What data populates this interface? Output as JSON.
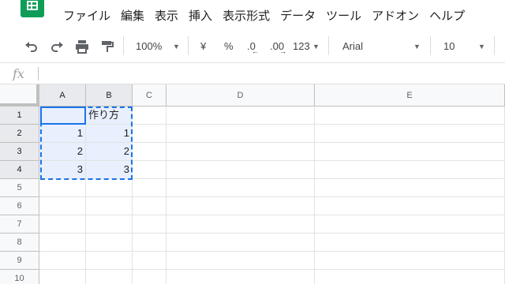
{
  "menu": {
    "items": [
      "ファイル",
      "編集",
      "表示",
      "挿入",
      "表示形式",
      "データ",
      "ツール",
      "アドオン",
      "ヘルプ"
    ]
  },
  "toolbar": {
    "undo_icon": "undo-icon",
    "redo_icon": "redo-icon",
    "print_icon": "print-icon",
    "paint_format_icon": "paint-format-icon",
    "zoom": "100%",
    "currency": "¥",
    "percent": "%",
    "decrease_decimal": ".0",
    "increase_decimal": ".00",
    "more_formats": "123",
    "font": "Arial",
    "font_size": "10"
  },
  "formula_bar": {
    "fx_label": "fx",
    "value": ""
  },
  "sheet": {
    "columns": [
      "A",
      "B",
      "C",
      "D",
      "E"
    ],
    "rows": [
      "1",
      "2",
      "3",
      "4",
      "5",
      "6",
      "7",
      "8",
      "9",
      "10"
    ],
    "cells": {
      "A1": "",
      "B1": "作り方",
      "A2": "1",
      "B2": "1",
      "A3": "2",
      "B3": "2",
      "A4": "3",
      "B4": "3"
    },
    "selected_range": "A1:B4",
    "active_cell": "A1"
  },
  "colors": {
    "selection": "#1a73e8",
    "range_fill": "#e8f0fe",
    "header_bg": "#f8f9fa",
    "brand": "#0f9d58"
  }
}
